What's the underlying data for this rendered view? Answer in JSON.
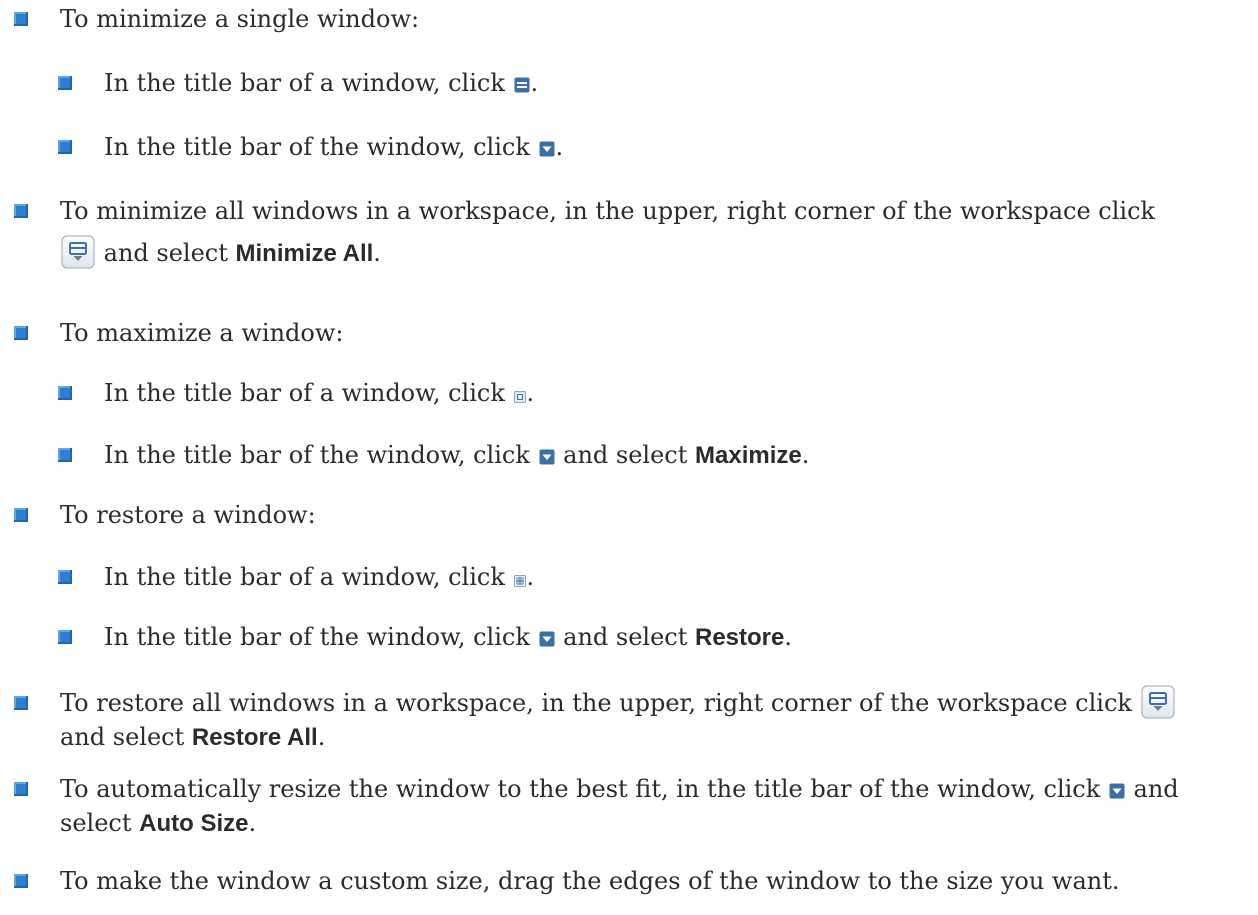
{
  "items": [
    {
      "text": [
        "To minimize a single window:"
      ]
    },
    {
      "text": [
        "In the title bar of a window, click ",
        "."
      ]
    },
    {
      "text": [
        "In the title bar of the window, click ",
        "."
      ]
    },
    {
      "text": [
        "To minimize all windows in a workspace, in the upper, right corner of the workspace click",
        " and select ",
        "Minimize All",
        "."
      ]
    },
    {
      "text": [
        "To maximize a window:"
      ]
    },
    {
      "text": [
        "In the title bar of a window, click ",
        "."
      ]
    },
    {
      "text": [
        "In the title bar of the window, click ",
        " and select ",
        "Maximize",
        "."
      ]
    },
    {
      "text": [
        "To restore a window:"
      ]
    },
    {
      "text": [
        "In the title bar of a window, click ",
        "."
      ]
    },
    {
      "text": [
        "In the title bar of the window, click ",
        " and select ",
        "Restore",
        "."
      ]
    },
    {
      "text": [
        "To restore all windows in a workspace, in the upper, right corner of the workspace click ",
        "and select ",
        "Restore All",
        "."
      ]
    },
    {
      "text": [
        "To automatically resize the window to the best fit, in the title bar of the window, click ",
        " and",
        "select ",
        "Auto Size",
        "."
      ]
    },
    {
      "text": [
        "To make the window a custom size, drag the edges of the window to the size you want."
      ]
    }
  ],
  "icons": {
    "minimize": "minimize-icon",
    "dropdown": "dropdown-arrow-icon",
    "workspace_menu": "workspace-menu-icon",
    "maximize": "maximize-icon",
    "restore": "restore-icon"
  },
  "colors": {
    "bullet": "#2f7fd1",
    "icon_blue": "#3a6fa8",
    "text": "#2b2b2b"
  }
}
